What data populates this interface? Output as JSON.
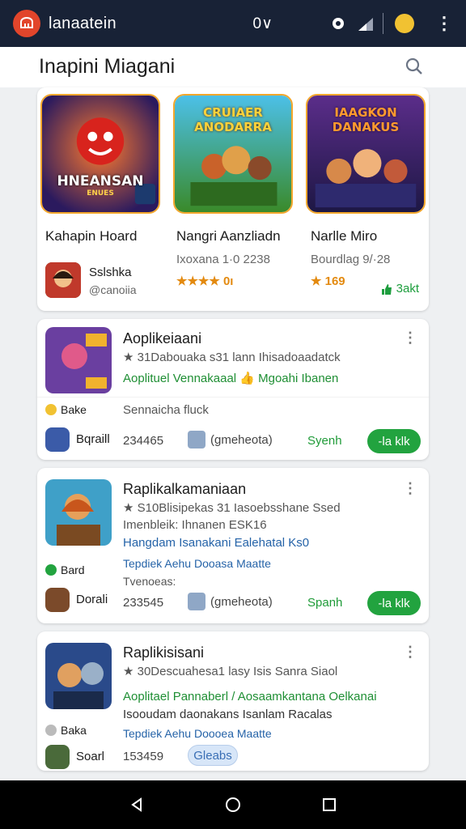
{
  "topbar": {
    "app_title": "lanaatein",
    "counter": "0∨"
  },
  "header": {
    "title": "Inapini Miagani"
  },
  "featured": {
    "tiles": [
      {
        "title": "HNEANSAN",
        "subtitle": "ENUES",
        "name": "Kahapin Hoard"
      },
      {
        "title": "CRUIAER ANODARRA",
        "subtitle": "",
        "name": "Nangri Aanzliadn",
        "sub": "Ixoxana 1·0 2238",
        "rating": "★★★★ 0ı"
      },
      {
        "title": "IAAGKON DANAKUS",
        "subtitle": "",
        "name": "Narlle Miro",
        "sub": "Bourdlag 9/·28",
        "rating": "★ 169"
      }
    ],
    "user_name": "Sslshka",
    "user_handle": "@canoiia",
    "action_label": "3akt"
  },
  "cards": [
    {
      "title": "Aoplikeiaani",
      "line1": "★ 31Dabouaka s31 lann Ihisadoaadatck",
      "line2": "Aoplituel  Vennakaaal 👍 Mgoahi Ibanen",
      "tag": "Bake",
      "tag_line": "Sennaicha fluck",
      "mini_name": "Bqraill",
      "number": "234465",
      "meta": "(gmeheota)",
      "open": "Syenh",
      "pill": "-la klk"
    },
    {
      "title": "Raplikalkamaniaan",
      "line1": "★ S10Blisipekas 31 Iasoebsshane Ssed",
      "line2": "Imenbleik: Ihnanen  ESK16",
      "line3": "Hangdam Isanakani  Ealehatal Ks0",
      "line4": "Tepdiek  Aehu Dooasa Maatte",
      "line5": "Tvenoeas:",
      "tag": "Bard",
      "mini_name": "Dorali",
      "number": "233545",
      "meta": "(gmeheota)",
      "open": "Spanh",
      "pill": "-la klk"
    },
    {
      "title": "Raplikisisani",
      "line1": "★ 30Descuahesa1 lasy Isis Sanra Siaol",
      "line2": "Aoplitael  Pannaberl / Aosaamkantana Oelkanai",
      "line3": "Isooudam daonakans Isanlam  Racalas",
      "line4": "Tepdiek  Aehu Doooea Maatte",
      "tag": "Baka",
      "mini_name": "Soarl",
      "number": "153459",
      "pill": "Gleabs"
    }
  ]
}
